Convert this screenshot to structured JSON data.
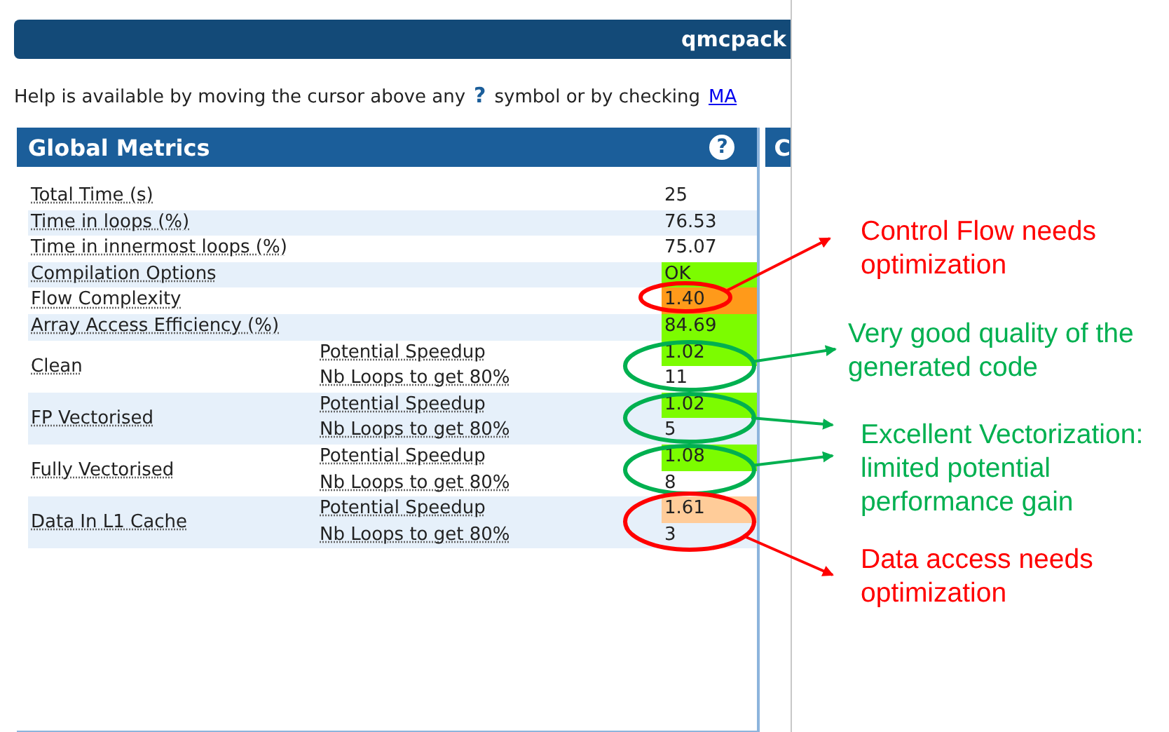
{
  "title_bar": {
    "title": "qmcpack"
  },
  "help": {
    "before": "Help is available by moving the cursor above any",
    "icon": "?",
    "after": "symbol or by checking",
    "link": "MA"
  },
  "panels": [
    {
      "title": "Global Metrics",
      "help_icon": "?"
    },
    {
      "title": "C"
    }
  ],
  "metrics": [
    {
      "kind": "single",
      "label": "Total Time (s)",
      "value": "25"
    },
    {
      "kind": "single",
      "label": "Time in loops (%)",
      "value": "76.53"
    },
    {
      "kind": "single",
      "label": "Time in innermost loops (%)",
      "value": "75.07"
    },
    {
      "kind": "single",
      "label": "Compilation Options",
      "value": "OK",
      "color": "#7cfc00"
    },
    {
      "kind": "single",
      "label": "Flow Complexity",
      "value": "1.40",
      "color": "#ff9a1a"
    },
    {
      "kind": "single",
      "label": "Array Access Efficiency (%)",
      "value": "84.69",
      "color": "#7cfc00"
    },
    {
      "kind": "group",
      "label": "Clean",
      "items": [
        {
          "label": "Potential Speedup",
          "value": "1.02",
          "color": "#7cfc00"
        },
        {
          "label": "Nb Loops to get 80%",
          "value": "11"
        }
      ]
    },
    {
      "kind": "group",
      "label": "FP Vectorised",
      "items": [
        {
          "label": "Potential Speedup",
          "value": "1.02",
          "color": "#7cfc00"
        },
        {
          "label": "Nb Loops to get 80%",
          "value": "5"
        }
      ]
    },
    {
      "kind": "group",
      "label": "Fully Vectorised",
      "items": [
        {
          "label": "Potential Speedup",
          "value": "1.08",
          "color": "#7cfc00"
        },
        {
          "label": "Nb Loops to get 80%",
          "value": "8"
        }
      ]
    },
    {
      "kind": "group",
      "label": "Data In L1 Cache",
      "items": [
        {
          "label": "Potential Speedup",
          "value": "1.61",
          "color": "#ffcc99"
        },
        {
          "label": "Nb Loops to get 80%",
          "value": "3"
        }
      ]
    }
  ],
  "annotations": [
    {
      "lines": [
        "Control Flow needs",
        "optimization"
      ],
      "color": "#ff0000"
    },
    {
      "lines": [
        "Very good quality of the",
        "generated code"
      ],
      "color": "#00b050"
    },
    {
      "lines": [
        "Excellent Vectorization:",
        "limited potential",
        "performance gain"
      ],
      "color": "#00b050"
    },
    {
      "lines": [
        "Data access needs",
        "optimization"
      ],
      "color": "#ff0000"
    }
  ]
}
